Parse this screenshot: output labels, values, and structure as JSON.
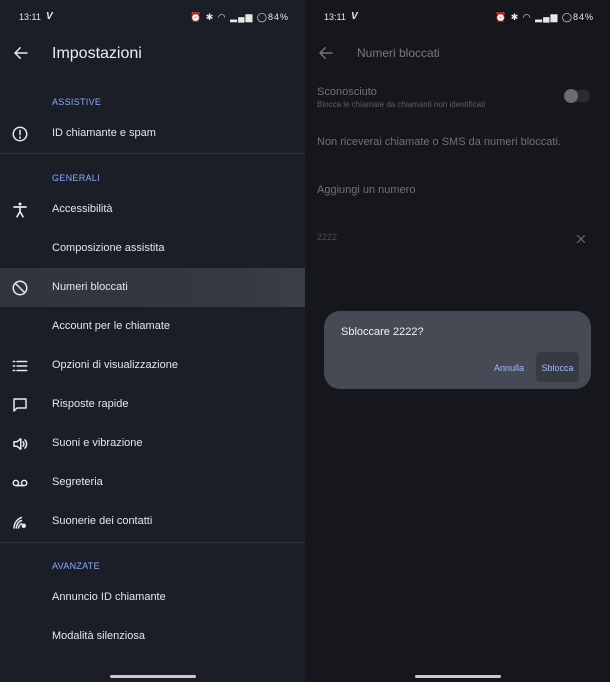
{
  "left": {
    "status": {
      "time": "13:11",
      "carrier": "V",
      "battery": "84%"
    },
    "header": {
      "title": "Impostazioni"
    },
    "sections": {
      "assistive": "ASSISTIVE",
      "generali": "GENERALI",
      "avanzate": "AVANZATE"
    },
    "items": [
      {
        "label": "ID chiamante e spam",
        "icon": "info-icon"
      },
      {
        "label": "Accessibilità",
        "icon": "accessibility-icon"
      },
      {
        "label": "Composizione assistita",
        "icon": ""
      },
      {
        "label": "Numeri bloccati",
        "icon": "block-icon",
        "selected": true
      },
      {
        "label": "Account per le chiamate",
        "icon": ""
      },
      {
        "label": "Opzioni di visualizzazione",
        "icon": "list-icon"
      },
      {
        "label": "Risposte rapide",
        "icon": "message-icon"
      },
      {
        "label": "Suoni e vibrazione",
        "icon": "volume-icon"
      },
      {
        "label": "Segreteria",
        "icon": "voicemail-icon"
      },
      {
        "label": "Suonerie dei contatti",
        "icon": "ringtone-icon"
      },
      {
        "label": "Annuncio ID chiamante",
        "icon": ""
      },
      {
        "label": "Modalità silenziosa",
        "icon": ""
      }
    ]
  },
  "right": {
    "status": {
      "time": "13:11",
      "carrier": "V",
      "battery": "84%"
    },
    "header": {
      "title": "Numeri bloccati"
    },
    "unknown": {
      "title": "Sconosciuto",
      "subtitle": "Blocca le chiamate da chiamanti non identificati",
      "enabled": false
    },
    "info": "Non riceverai chiamate o SMS da numeri bloccati.",
    "add_number": "Aggiungi un numero",
    "blocked_numbers": [
      "2222"
    ],
    "dialog": {
      "title": "Sbloccare 2222?",
      "cancel": "Annulla",
      "confirm": "Sblocca"
    }
  }
}
